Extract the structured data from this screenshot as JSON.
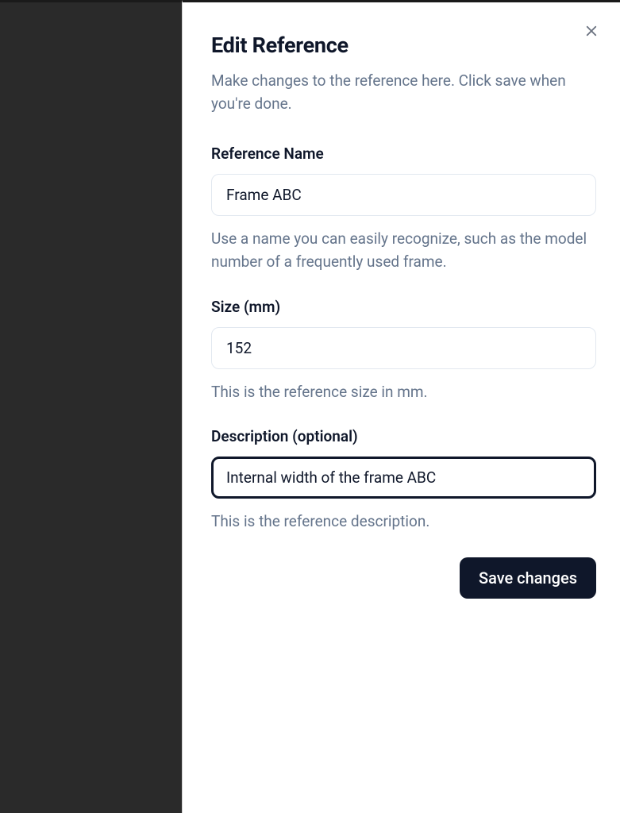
{
  "dialog": {
    "title": "Edit Reference",
    "subtitle": "Make changes to the reference here. Click save when you're done."
  },
  "fields": {
    "name": {
      "label": "Reference Name",
      "value": "Frame ABC",
      "hint": "Use a name you can easily recognize, such as the model number of a frequently used frame."
    },
    "size": {
      "label": "Size (mm)",
      "value": "152",
      "hint": "This is the reference size in mm."
    },
    "description": {
      "label": "Description (optional)",
      "value": "Internal width of the frame ABC",
      "hint": "This is the reference description."
    }
  },
  "buttons": {
    "save": "Save changes"
  }
}
